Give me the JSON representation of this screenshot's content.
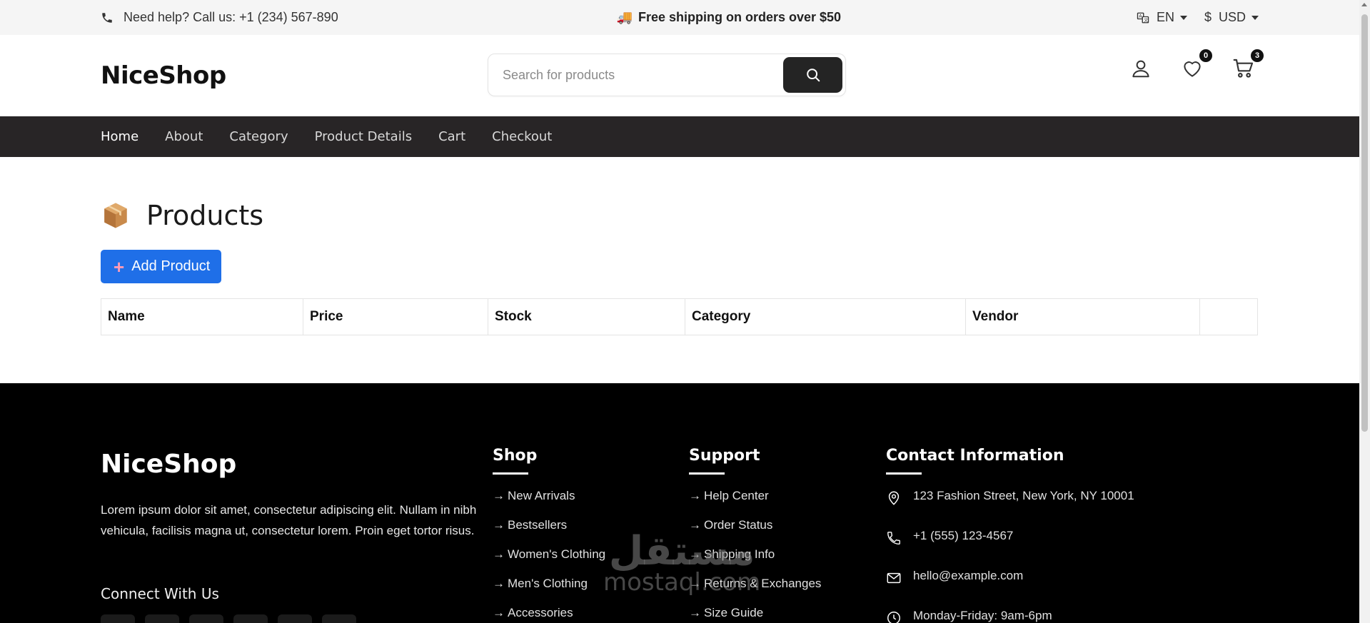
{
  "topbar": {
    "help_text": "Need help? Call us: +1 (234) 567-890",
    "shipping_text": "Free shipping on orders over $50",
    "language": "EN",
    "currency_symbol": "$",
    "currency": "USD"
  },
  "header": {
    "logo": "NiceShop",
    "search_placeholder": "Search for products",
    "wishlist_count": "0",
    "cart_count": "3"
  },
  "nav": {
    "items": [
      "Home",
      "About",
      "Category",
      "Product Details",
      "Cart",
      "Checkout"
    ],
    "active": "Home"
  },
  "main": {
    "title": "Products",
    "add_button": "Add Product",
    "table_headers": [
      "Name",
      "Price",
      "Stock",
      "Category",
      "Vendor",
      ""
    ]
  },
  "footer": {
    "logo": "NiceShop",
    "description": "Lorem ipsum dolor sit amet, consectetur adipiscing elit. Nullam in nibh vehicula, facilisis magna ut, consectetur lorem. Proin eget tortor risus.",
    "connect_heading": "Connect With Us",
    "shop": {
      "heading": "Shop",
      "links": [
        "New Arrivals",
        "Bestsellers",
        "Women's Clothing",
        "Men's Clothing",
        "Accessories"
      ]
    },
    "support": {
      "heading": "Support",
      "links": [
        "Help Center",
        "Order Status",
        "Shipping Info",
        "Returns & Exchanges",
        "Size Guide"
      ]
    },
    "contact": {
      "heading": "Contact Information",
      "address": "123 Fashion Street, New York, NY 10001",
      "phone": "+1 (555) 123-4567",
      "email": "hello@example.com",
      "hours": "Monday-Friday: 9am-6pm"
    }
  },
  "watermark": {
    "arabic": "مستقل",
    "latin": "mostaql.com"
  },
  "colors": {
    "nav_bg": "#282526",
    "primary": "#1f6fe8",
    "footer_bg": "#000000"
  }
}
